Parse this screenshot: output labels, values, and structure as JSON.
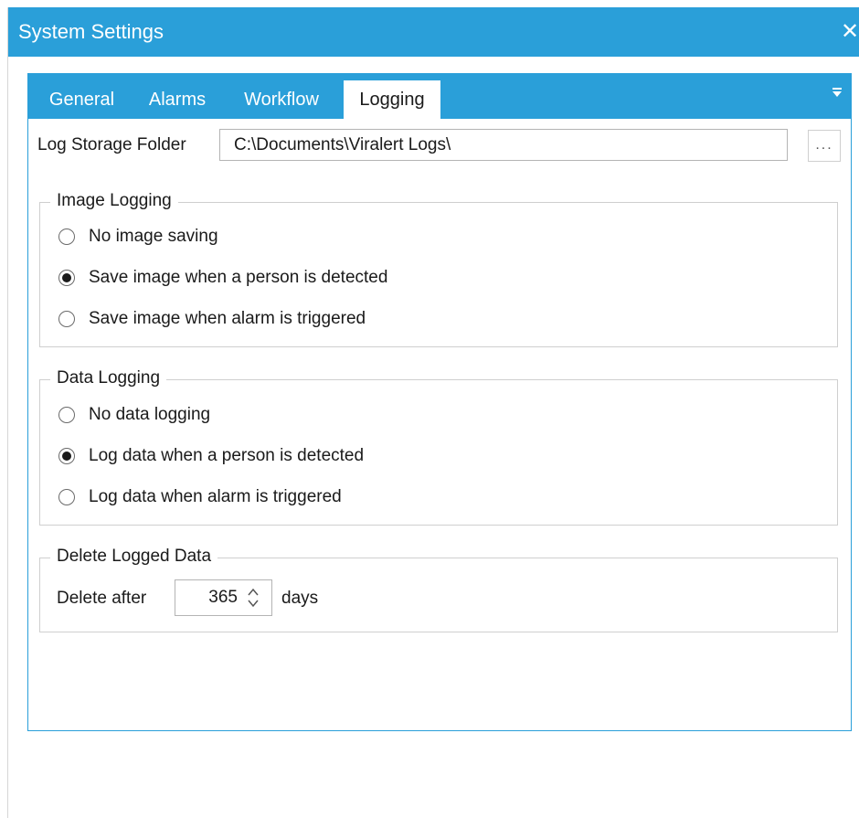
{
  "window": {
    "title": "System Settings",
    "close_glyph": "✕"
  },
  "tabs": [
    {
      "label": "General",
      "active": false
    },
    {
      "label": "Alarms",
      "active": false
    },
    {
      "label": "Workflow",
      "active": false
    },
    {
      "label": "Logging",
      "active": true
    }
  ],
  "tab_menu_icon": "dropdown-arrow-icon",
  "log_folder": {
    "label": "Log Storage Folder",
    "value": "C:\\Documents\\Viralert Logs\\",
    "browse_label": "..."
  },
  "image_logging": {
    "title": "Image Logging",
    "options": [
      {
        "label": "No image saving",
        "selected": false
      },
      {
        "label": "Save image when a person is detected",
        "selected": true
      },
      {
        "label": "Save image when alarm is triggered",
        "selected": false
      }
    ]
  },
  "data_logging": {
    "title": "Data Logging",
    "options": [
      {
        "label": "No data logging",
        "selected": false
      },
      {
        "label": "Log data when a person is detected",
        "selected": true
      },
      {
        "label": "Log data when alarm is triggered",
        "selected": false
      }
    ]
  },
  "delete_logged": {
    "title": "Delete Logged Data",
    "label": "Delete after",
    "value": "365",
    "unit": "days"
  },
  "colors": {
    "accent": "#2a9fd9"
  }
}
